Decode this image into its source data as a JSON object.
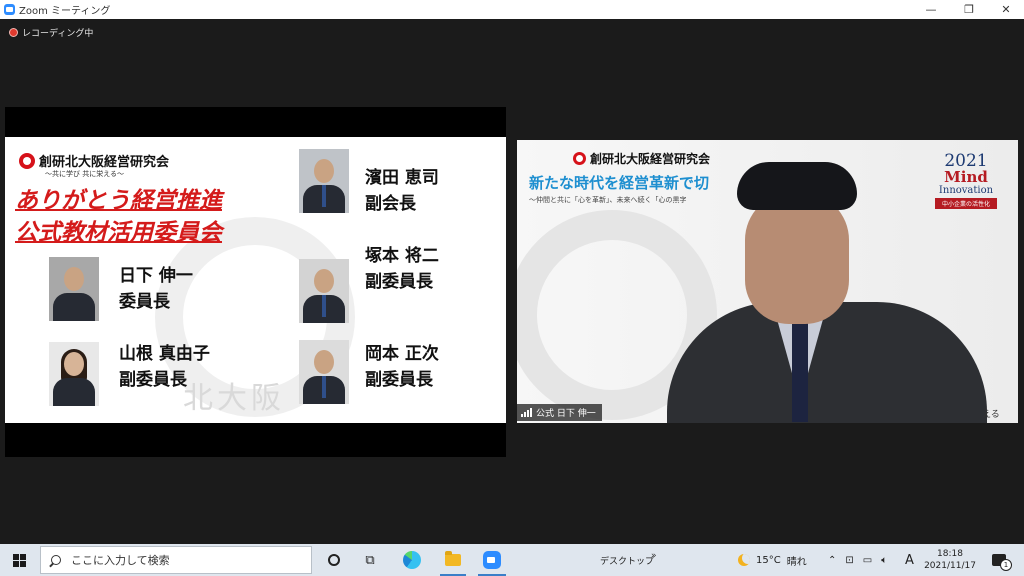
{
  "window": {
    "title": "Zoom ミーティング"
  },
  "recording": {
    "label": "レコーディング中",
    "color": "#e03a2e"
  },
  "slide": {
    "org_name": "創研北大阪経営研究会",
    "org_tagline": "〜共に学び 共に栄える〜",
    "headline_line1": "ありがとう経営推進",
    "headline_line2": "公式教材活用委員会",
    "watermark": "北大阪",
    "people": [
      {
        "name": "濱田 恵司",
        "role": "副会長"
      },
      {
        "name": "日下 伸一",
        "role": "委員長"
      },
      {
        "name": "塚本 将二",
        "role": "副委員長"
      },
      {
        "name": "山根 真由子",
        "role": "副委員長"
      },
      {
        "name": "岡本 正次",
        "role": "副委員長"
      }
    ]
  },
  "video": {
    "org_name": "創研北大阪経営研究会",
    "headline": "新たな時代を経営革新で切",
    "subline": "〜仲間と共に「心を革新」、未来へ続く「心の黒字",
    "badge_year": "2021",
    "badge_line1": "Mind",
    "badge_line2": "Innovation",
    "badge_line3": "中小企業の活性化",
    "trailing_text": "える",
    "participant_label": "公式 日下 伸一"
  },
  "taskbar": {
    "search_placeholder": "ここに入力して検索",
    "desktop_label": "デスクトップ",
    "chevron": "»",
    "weather_temp": "15°C",
    "weather_text": "晴れ",
    "ime_label": "A",
    "time": "18:18",
    "date": "2021/11/17",
    "notification_count": "1",
    "icons": [
      "windows-logo-icon",
      "search-icon",
      "cortana-icon",
      "task-view-icon",
      "edge-icon",
      "file-explorer-icon",
      "zoom-icon",
      "moon-icon",
      "chevron-up-icon",
      "network-icon",
      "battery-icon",
      "volume-icon",
      "notification-icon"
    ]
  },
  "colors": {
    "accent": "#2d8cff",
    "headline_red": "#d41b1b",
    "video_headline_blue": "#1e8fd0"
  }
}
